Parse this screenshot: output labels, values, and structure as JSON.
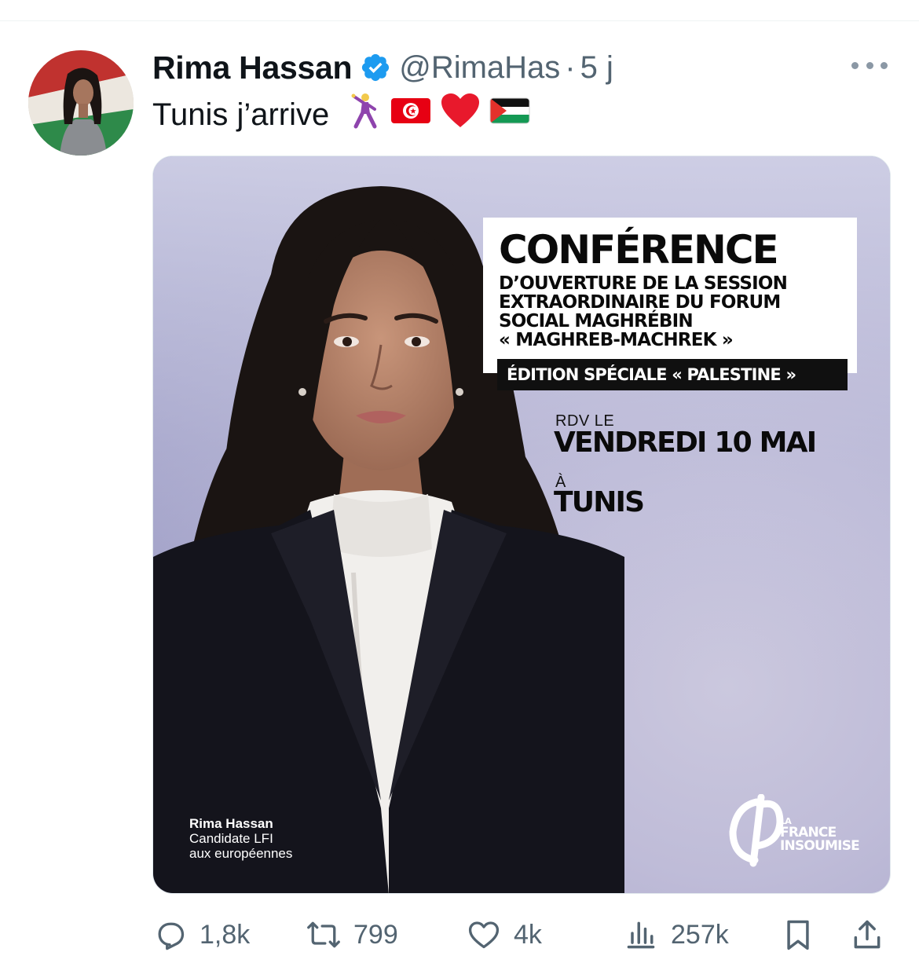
{
  "tweet": {
    "display_name": "Rima Hassan",
    "handle": "@RimaHas",
    "separator": "·",
    "time": "5 j",
    "text": "Tunis j’arrive",
    "emojis": [
      "dancer-emoji",
      "tunisia-flag-emoji",
      "red-heart-emoji",
      "palestine-flag-emoji"
    ]
  },
  "media": {
    "conference_title": "CONFÉRENCE",
    "conference_lines": [
      "D’OUVERTURE DE LA SESSION",
      "EXTRAORDINAIRE DU FORUM",
      "SOCIAL MAGHRÉBIN",
      "« MAGHREB-MACHREK »"
    ],
    "edition": "ÉDITION SPÉCIALE « PALESTINE »",
    "rdv_prefix": "RDV LE",
    "date": "VENDREDI 10 MAI",
    "a_prefix": "À",
    "city": "TUNIS",
    "caption_name": "Rima Hassan",
    "caption_line1": "Candidate LFI",
    "caption_line2": "aux européennes",
    "logo_lines": [
      "LA",
      "FRANCE",
      "INSOUMISE"
    ]
  },
  "actions": {
    "replies": "1,8k",
    "reposts": "799",
    "likes": "4k",
    "views": "257k"
  },
  "colors": {
    "text": "#0f1419",
    "secondary": "#536471",
    "verified": "#1d9bf0",
    "media_bg": "#a9a7cb"
  }
}
